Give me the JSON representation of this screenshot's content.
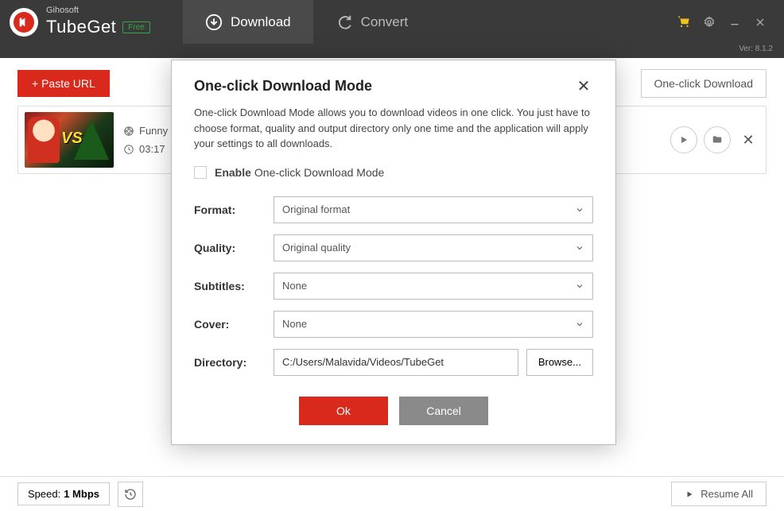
{
  "brand": {
    "company": "Gihosoft",
    "name": "TubeGet",
    "badge": "Free"
  },
  "tabs": {
    "download": "Download",
    "convert": "Convert"
  },
  "version": "Ver: 8.1.2",
  "toolbar": {
    "paste": "+ Paste URL",
    "oneclick": "One-click Download"
  },
  "video": {
    "title": "Funny Ca",
    "duration": "03:17"
  },
  "dialog": {
    "title": "One-click Download Mode",
    "desc": "One-click Download Mode allows you to download videos in one click.  You just have to choose format,  quality and output directory only one time and the application will apply your settings to all downloads.",
    "enable_bold": "Enable",
    "enable_rest": "One-click Download Mode",
    "labels": {
      "format": "Format:",
      "quality": "Quality:",
      "subtitles": "Subtitles:",
      "cover": "Cover:",
      "directory": "Directory:"
    },
    "values": {
      "format": "Original format",
      "quality": "Original quality",
      "subtitles": "None",
      "cover": "None",
      "directory": "C:/Users/Malavida/Videos/TubeGet"
    },
    "browse": "Browse...",
    "ok": "Ok",
    "cancel": "Cancel"
  },
  "footer": {
    "speed_label": "Speed:",
    "speed_value": "1 Mbps",
    "resume": "Resume All"
  }
}
